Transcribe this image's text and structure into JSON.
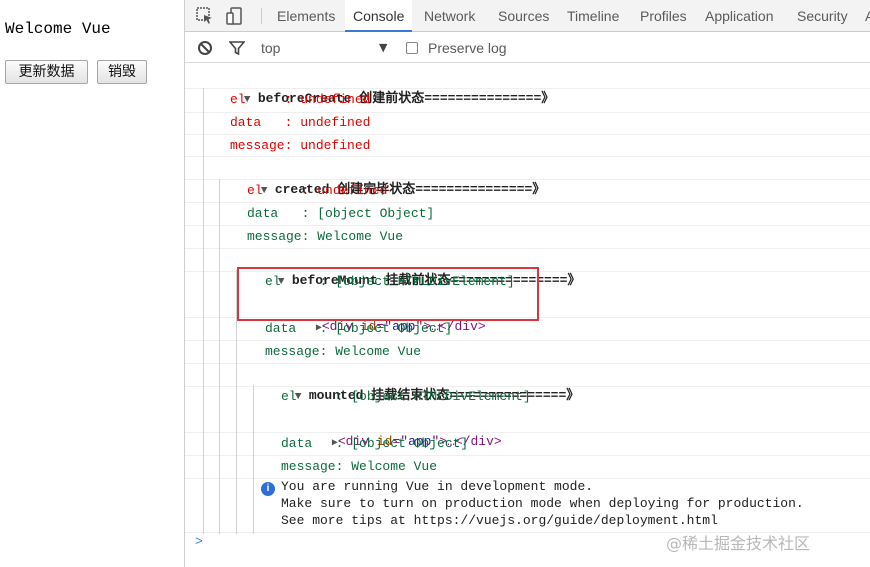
{
  "page": {
    "welcome": "Welcome Vue",
    "update_button": "更新数据",
    "destroy_button": "销毁"
  },
  "devtools": {
    "tabs": [
      "Elements",
      "Console",
      "Network",
      "Sources",
      "Timeline",
      "Profiles",
      "Application",
      "Security",
      "A"
    ],
    "active_tab": "Console",
    "filter": {
      "context": "top",
      "preserve_log": "Preserve log"
    },
    "console": {
      "beforeCreate": {
        "header_name": "beforeCreate",
        "header_text": " 创建前状态===============》",
        "el": "el     : undefined",
        "data": "data   : undefined",
        "message": "message: undefined"
      },
      "created": {
        "header_name": "created",
        "header_text": " 创建完毕状态===============》",
        "el": "el     : undefined",
        "data": "data   : [object Object]",
        "message": "message: Welcome Vue"
      },
      "beforeMount": {
        "header_name": "beforeMount",
        "header_text": " 挂载前状态===============》",
        "el": "el     : [object HTMLDivElement]",
        "node_open": "<div ",
        "node_attr": "id",
        "node_eq": "=\"",
        "node_val": "app",
        "node_close": "\">…</div>",
        "data": "data   : [object Object]",
        "message": "message: Welcome Vue"
      },
      "mounted": {
        "header_name": "mounted",
        "header_text": " 挂载结束状态===============》",
        "el": "el     : [object HTMLDivElement]",
        "node_open": "<div ",
        "node_attr": "id",
        "node_eq": "=\"",
        "node_val": "app",
        "node_close": "\">…</div>",
        "data": "data   : [object Object]",
        "message": "message: Welcome Vue"
      },
      "info": {
        "line1": "You are running Vue in development mode.",
        "line2": "Make sure to turn on production mode when deploying for production.",
        "line3": "See more tips at https://vuejs.org/guide/deployment.html"
      },
      "prompt": ">"
    }
  },
  "watermark": "@稀土掘金技术社区"
}
